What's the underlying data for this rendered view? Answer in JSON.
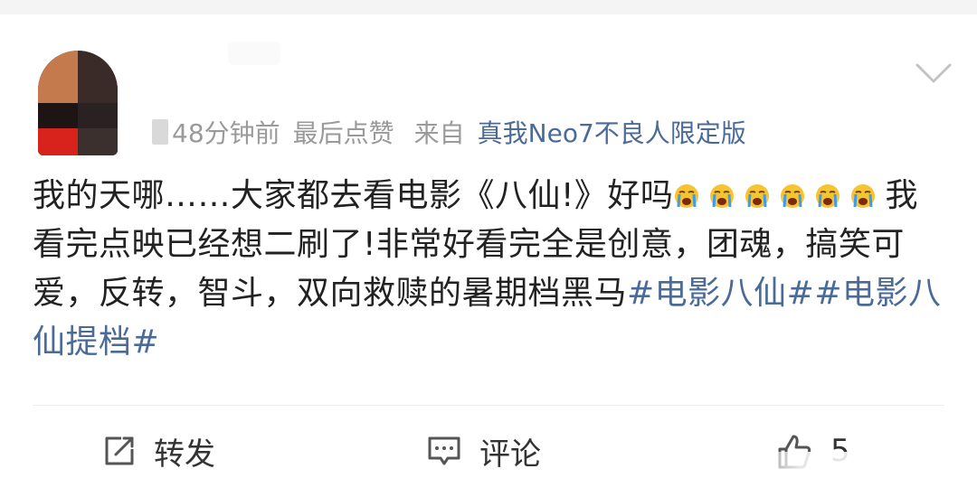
{
  "post": {
    "meta": {
      "time": "48分钟前",
      "liked_note": "最后点赞",
      "from_label": "来自",
      "device": "真我Neo7不良人限定版"
    },
    "text_line1": "我的天哪……大家都去看电影《八仙!》好吗",
    "text_line2": "我看完点映已经想二刷了!非常好看完全是创意，团魂，搞笑可爱，反转，智斗，双向救赎的暑期档黑马",
    "hashtag1": "#电影八仙#",
    "hashtag2": "#电影八仙提档#",
    "emoji": "crying-face-icon"
  },
  "actions": {
    "repost_label": "转发",
    "comment_label": "评论",
    "like_count": "5"
  },
  "colors": {
    "link": "#4a6a98",
    "meta": "#9a9a9a",
    "text": "#222222"
  }
}
